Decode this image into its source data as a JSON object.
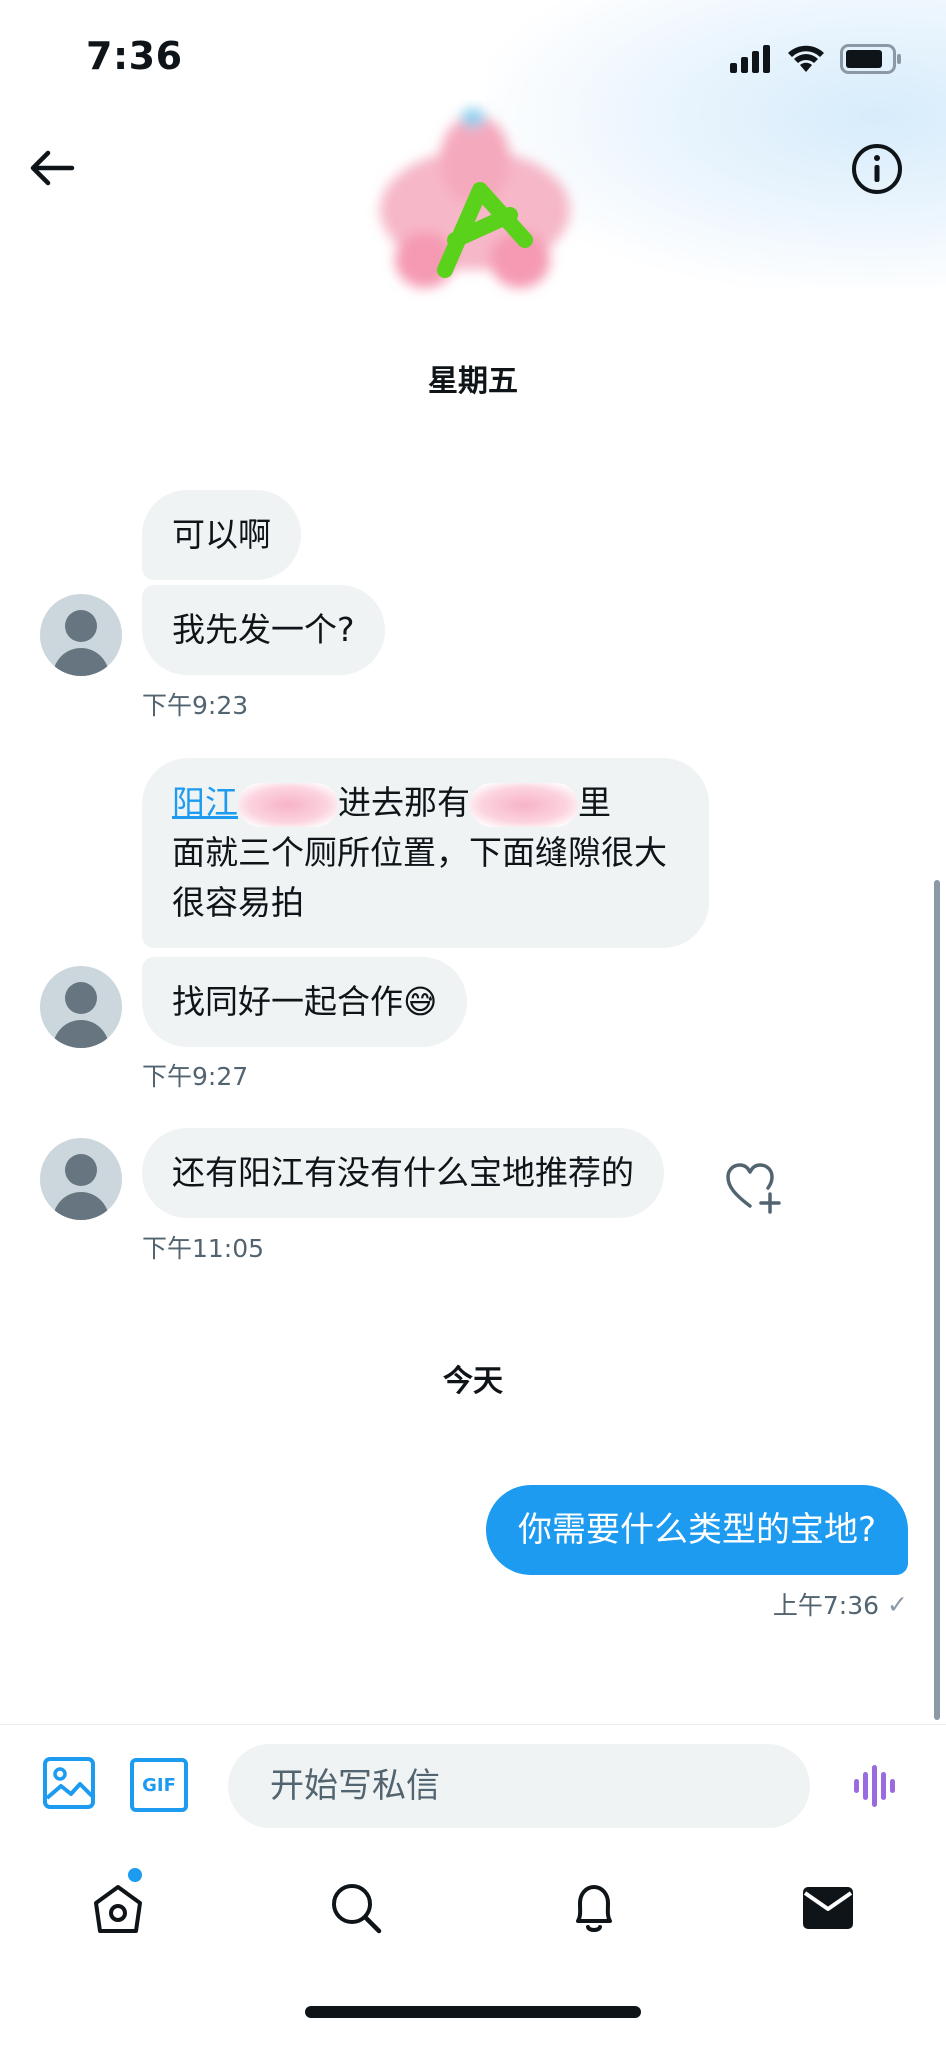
{
  "status_bar": {
    "time": "7:36"
  },
  "header": {
    "back_label": "back",
    "info_label": "info"
  },
  "date_separators": {
    "friday": "星期五",
    "today": "今天"
  },
  "messages": {
    "m1": "可以啊",
    "m2": "我先发一个?",
    "t1": "下午9:23",
    "m3_link": "阳江",
    "m3_part1": "进去那有",
    "m3_part2": "里",
    "m3_rest": "面就三个厕所位置，下面缝隙很大很容易拍",
    "m4": "找同好一起合作😅",
    "t2": "下午9:27",
    "m5": "还有阳江有没有什么宝地推荐的",
    "t3": "下午11:05",
    "mine": "你需要什么类型的宝地?",
    "mine_time": "上午7:36",
    "mine_read_mark": "✓"
  },
  "composer": {
    "placeholder": "开始写私信",
    "gif_label": "GIF"
  },
  "colors": {
    "accent": "#1d9bf0",
    "bubble_gray": "#eff3f4",
    "voice_purple": "#9a6ae0"
  },
  "icons": {
    "status": [
      "cellular-signal-icon",
      "wifi-icon",
      "battery-icon"
    ],
    "nav": [
      "home-icon",
      "search-icon",
      "notifications-bell-icon",
      "mail-icon"
    ]
  }
}
